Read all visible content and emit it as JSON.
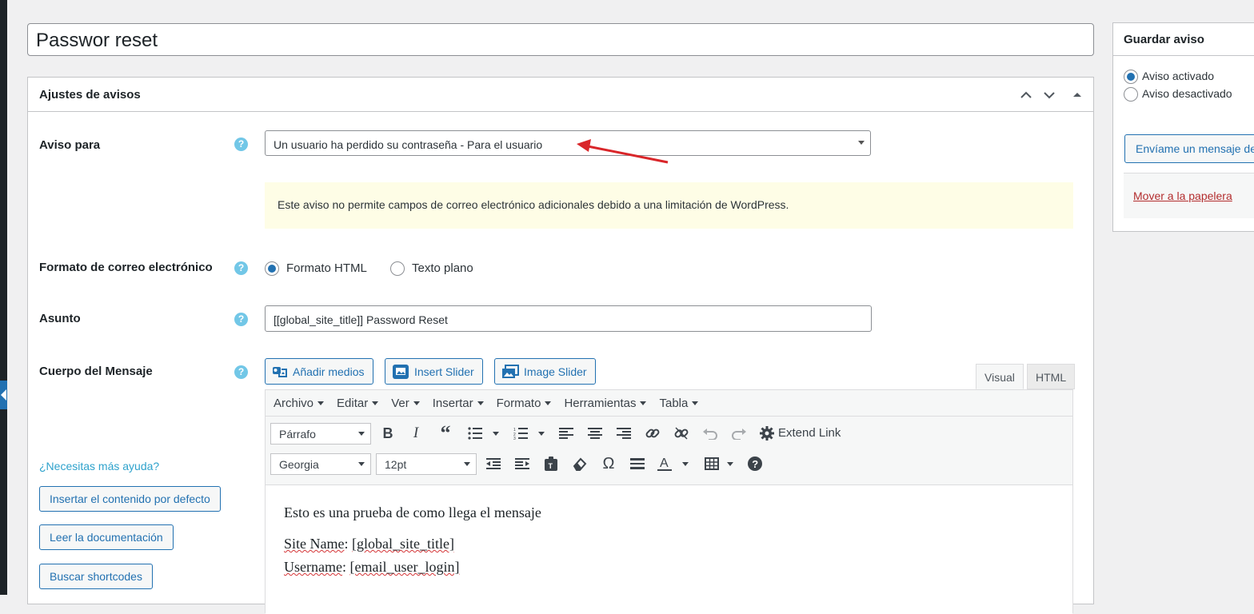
{
  "post_title": "Passwor reset",
  "metabox": {
    "title": "Ajustes de avisos",
    "aviso_para": {
      "label": "Aviso para",
      "selected": "Un usuario ha perdido su contraseña - Para el usuario"
    },
    "notice_text": "Este aviso no permite campos de correo electrónico adicionales debido a una limitación de WordPress.",
    "formato": {
      "label": "Formato de correo electrónico",
      "options": [
        "Formato HTML",
        "Texto plano"
      ],
      "selected": "Formato HTML"
    },
    "asunto": {
      "label": "Asunto",
      "value": "[[global_site_title]] Password Reset"
    },
    "cuerpo": {
      "label": "Cuerpo del Mensaje",
      "media_buttons": [
        "Añadir medios",
        "Insert Slider",
        "Image Slider"
      ],
      "tabs": [
        "Visual",
        "HTML"
      ],
      "active_tab": "Visual",
      "menubar": [
        "Archivo",
        "Editar",
        "Ver",
        "Insertar",
        "Formato",
        "Herramientas",
        "Tabla"
      ],
      "format_select": "Párrafo",
      "font_select": "Georgia",
      "size_select": "12pt",
      "extend_link": "Extend Link",
      "content": {
        "line1": "Esto es una prueba de como llega el mensaje",
        "site_name_label": "Site Name",
        "site_name_value": "[global_site_title]",
        "username_label": "Username",
        "username_value": "[email_user_login]"
      }
    },
    "help": {
      "link": "¿Necesitas más ayuda?",
      "buttons": [
        "Insertar el contenido por defecto",
        "Leer la documentación",
        "Buscar shortcodes"
      ]
    }
  },
  "sidebar": {
    "title": "Guardar aviso",
    "status_options": [
      "Aviso activado",
      "Aviso desactivado"
    ],
    "selected_status": "Aviso activado",
    "send_button": "Envíame un mensaje de",
    "trash_link": "Mover a la papelera"
  },
  "colors": {
    "accent": "#2271b1",
    "help_icon": "#72c7e7",
    "notice_bg": "#fefde6",
    "annotation_arrow": "#d9262a"
  }
}
